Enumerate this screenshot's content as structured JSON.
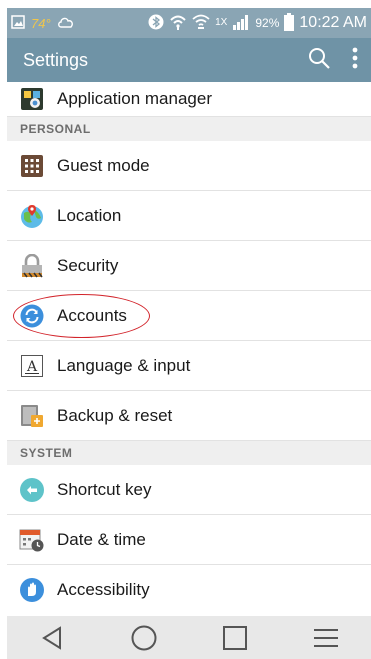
{
  "status_bar": {
    "temperature": "74°",
    "battery_percent": "92%",
    "network_label": "1X",
    "time": "10:22 AM"
  },
  "app_bar": {
    "title": "Settings",
    "search_icon": "search-icon",
    "overflow_icon": "more-vert-icon"
  },
  "list": {
    "top_item": {
      "label": "Application manager",
      "icon": "application-manager-icon"
    },
    "sections": [
      {
        "header": "PERSONAL",
        "items": [
          {
            "label": "Guest mode",
            "icon": "guest-mode-icon"
          },
          {
            "label": "Location",
            "icon": "location-icon"
          },
          {
            "label": "Security",
            "icon": "security-lock-icon"
          },
          {
            "label": "Accounts",
            "icon": "accounts-sync-icon",
            "highlighted": true
          },
          {
            "label": "Language & input",
            "icon": "language-input-icon"
          },
          {
            "label": "Backup & reset",
            "icon": "backup-reset-icon"
          }
        ]
      },
      {
        "header": "SYSTEM",
        "items": [
          {
            "label": "Shortcut key",
            "icon": "shortcut-key-icon"
          },
          {
            "label": "Date & time",
            "icon": "date-time-icon"
          },
          {
            "label": "Accessibility",
            "icon": "accessibility-icon"
          }
        ]
      }
    ]
  },
  "nav_bar": {
    "back_icon": "back-triangle-icon",
    "home_icon": "home-circle-icon",
    "recents_icon": "recents-square-icon",
    "menu_icon": "menu-lines-icon"
  },
  "colors": {
    "status_bar": "#8aa5b4",
    "app_bar": "#6f93a6",
    "section_bg": "#efefef",
    "highlight": "#d2232a",
    "nav_bar": "#e8e8e8"
  }
}
